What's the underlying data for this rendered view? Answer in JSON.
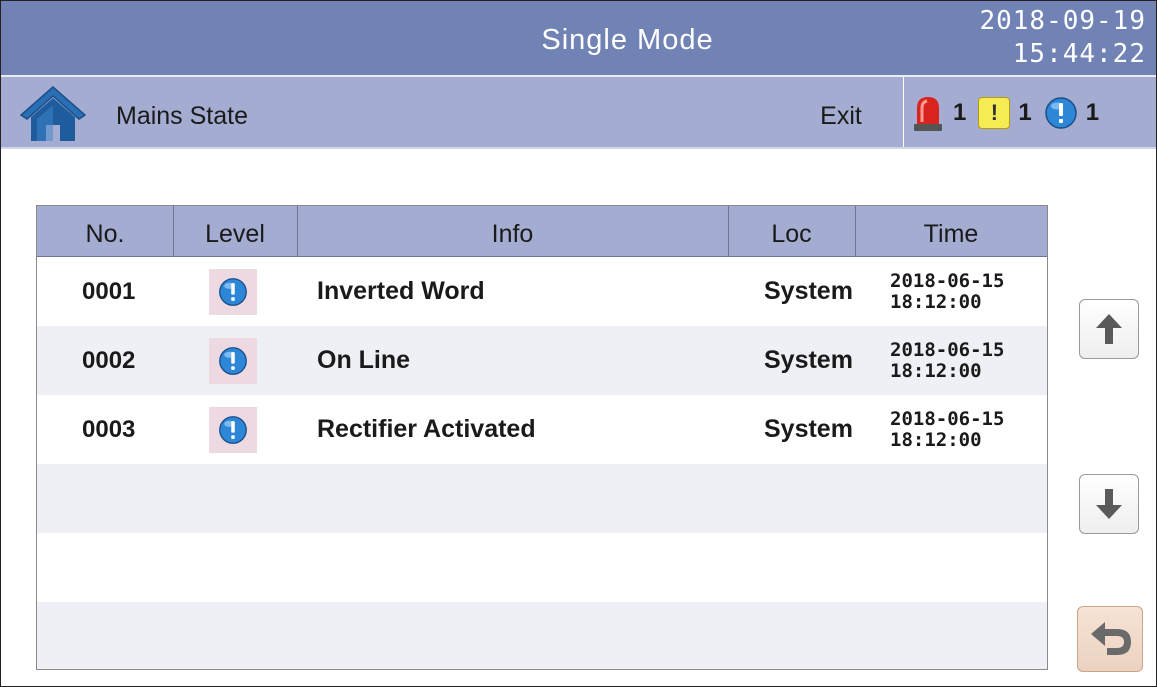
{
  "header": {
    "title": "Single Mode",
    "date": "2018-09-19",
    "time": "15:44:22"
  },
  "subheader": {
    "screen_name": "Mains State",
    "exit_label": "Exit",
    "alarms": {
      "critical_count": "1",
      "warning_count": "1",
      "info_count": "1"
    }
  },
  "table": {
    "columns": [
      "No.",
      "Level",
      "Info",
      "Loc",
      "Time"
    ],
    "rows": [
      {
        "no": "0001",
        "level_icon": "info-icon",
        "info": "Inverted Word",
        "loc": "System",
        "date": "2018-06-15",
        "time": "18:12:00"
      },
      {
        "no": "0002",
        "level_icon": "info-icon",
        "info": "On Line",
        "loc": "System",
        "date": "2018-06-15",
        "time": "18:12:00"
      },
      {
        "no": "0003",
        "level_icon": "info-icon",
        "info": "Rectifier Activated",
        "loc": "System",
        "date": "2018-06-15",
        "time": "18:12:00"
      }
    ]
  },
  "icons": {
    "home": "home-icon",
    "critical": "siren-icon",
    "warning": "warning-icon",
    "info": "info-icon",
    "scroll_up": "arrow-up-icon",
    "scroll_down": "arrow-down-icon",
    "back": "return-arrow-icon"
  },
  "colors": {
    "title_bar": "#7183b5",
    "sub_bar": "#a4add1",
    "info_blue": "#2e86d6",
    "warning_yellow": "#f4ec52",
    "critical_red": "#d8231f"
  }
}
